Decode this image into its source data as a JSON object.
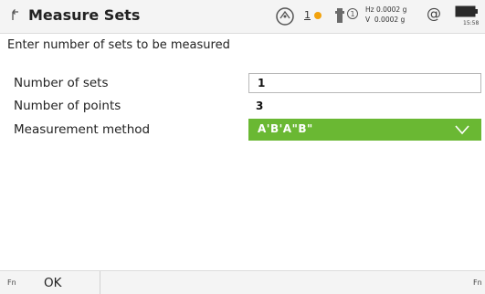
{
  "header": {
    "title": "Measure Sets",
    "back_icon": "back-arrow-icon",
    "status": {
      "face_indicator": "1",
      "face_dot_color": "#f2a20c",
      "hz_readout": "Hz 0.0002 g",
      "v_readout": "V  0.0002 g",
      "prism_channel": "1",
      "at_symbol": "@",
      "time": "15:58"
    }
  },
  "instruction": "Enter number of sets to be measured",
  "fields": {
    "number_of_sets": {
      "label": "Number of sets",
      "value": "1"
    },
    "number_of_points": {
      "label": "Number of points",
      "value": "3"
    },
    "measurement_method": {
      "label": "Measurement method",
      "value": "A'B'A\"B\"",
      "accent": "#6ab833"
    }
  },
  "footer": {
    "fn_left": "Fn",
    "ok_label": "OK",
    "fn_right": "Fn"
  }
}
